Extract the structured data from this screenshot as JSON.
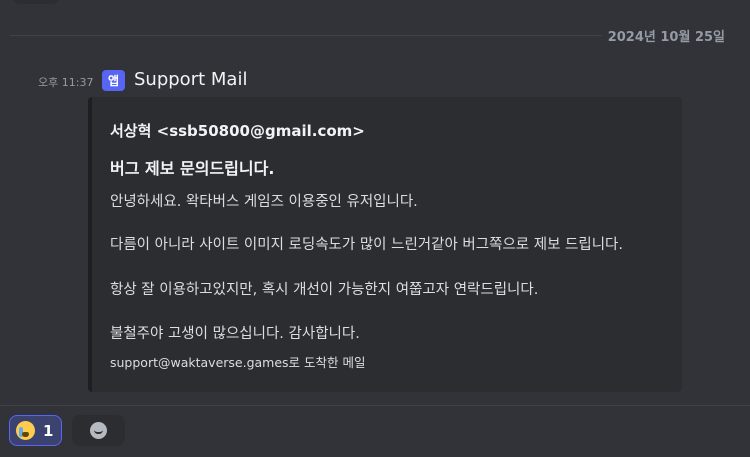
{
  "divider": {
    "date": "2024년 10월 25일"
  },
  "message": {
    "time": "오후 11:37",
    "app_badge": "앱",
    "sender": "Support Mail",
    "embed": {
      "author": "서상혁 <ssb50800@gmail.com>",
      "title": "버그 제보 문의드립니다.",
      "lines": [
        "안녕하세요. 왁타버스 게임즈 이용중인 유저입니다.",
        "다름이 아니라 사이트 이미지 로딩속도가 많이 느린거같아 버그쪽으로 제보 드립니다.",
        "항상 잘 이용하고있지만, 혹시 개선이 가능한지 여쭙고자 연락드립니다.",
        "불철주야 고생이 많으십니다. 감사합니다."
      ],
      "footer": "support@waktaverse.games로 도착한 메일"
    }
  },
  "reactions": [
    {
      "icon": "loudly-crying-face-icon",
      "count": "1",
      "selected": true
    }
  ],
  "add_reaction": {
    "icon": "smile-face-icon"
  },
  "colors": {
    "background": "#313338",
    "embed_background": "#2b2d31",
    "accent": "#5865f2",
    "muted_text": "#949ba4"
  }
}
